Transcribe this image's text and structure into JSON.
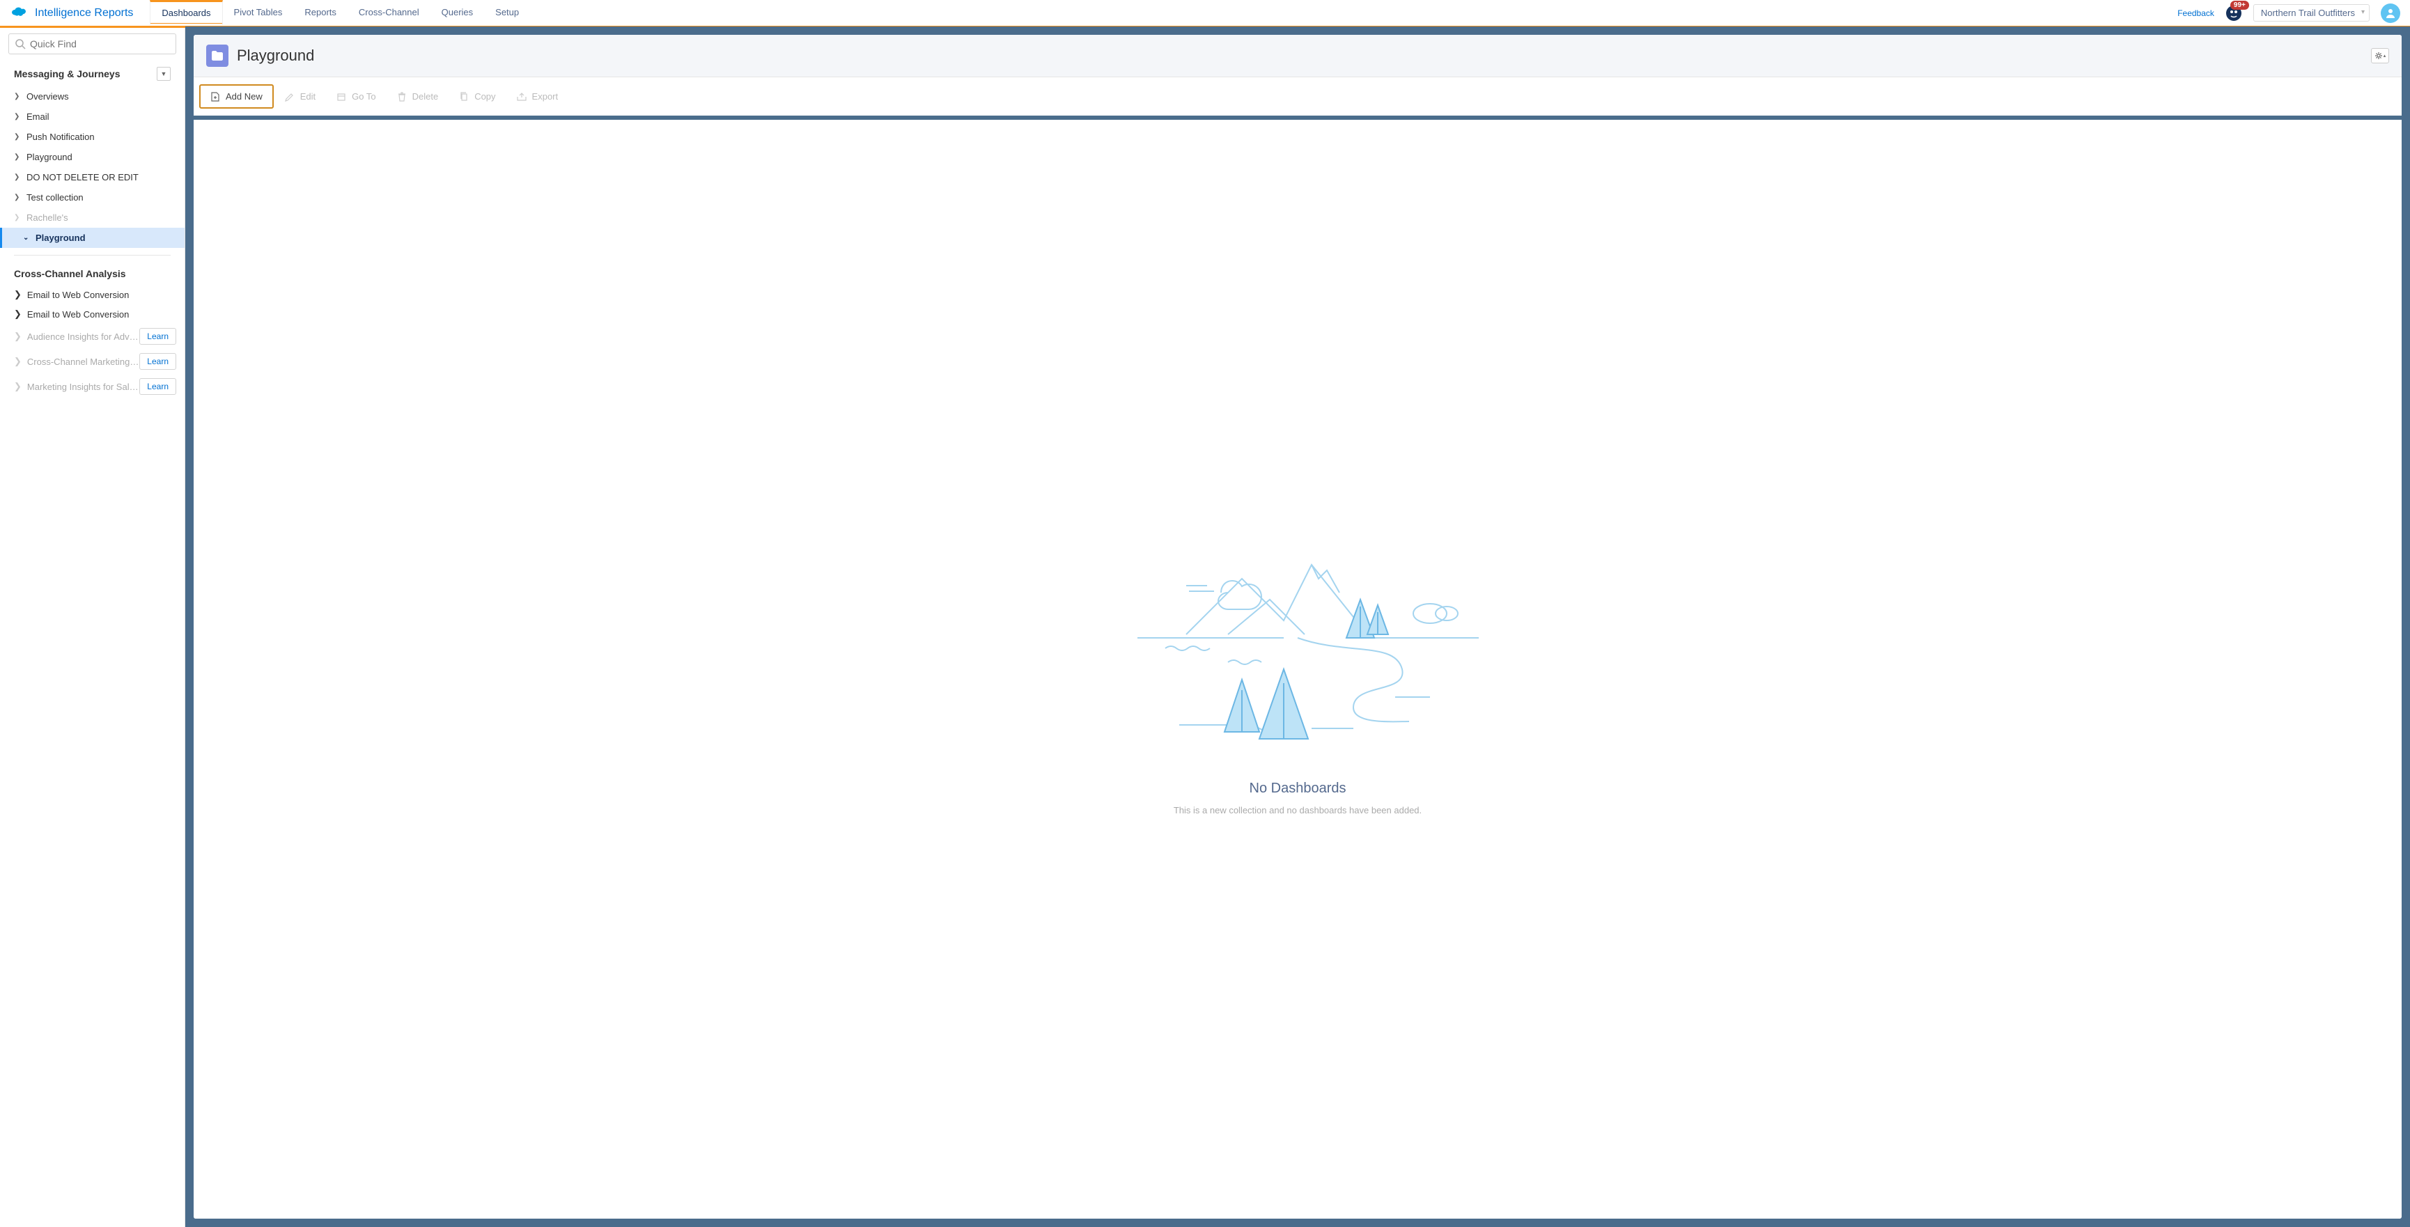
{
  "brand": {
    "name": "Intelligence Reports"
  },
  "nav": {
    "tabs": [
      {
        "label": "Dashboards",
        "active": true
      },
      {
        "label": "Pivot Tables"
      },
      {
        "label": "Reports"
      },
      {
        "label": "Cross-Channel"
      },
      {
        "label": "Queries"
      },
      {
        "label": "Setup"
      }
    ],
    "feedback": "Feedback",
    "badge": "99+",
    "org": "Northern Trail Outfitters"
  },
  "sidebar": {
    "search_placeholder": "Quick Find",
    "section": "Messaging & Journeys",
    "items": [
      {
        "label": "Overviews"
      },
      {
        "label": "Email"
      },
      {
        "label": "Push Notification"
      },
      {
        "label": "Playground"
      },
      {
        "label": "DO NOT DELETE OR EDIT"
      },
      {
        "label": "Test collection"
      },
      {
        "label": "Rachelle's",
        "muted": true
      },
      {
        "label": "Playground",
        "selected": true
      }
    ],
    "section2": "Cross-Channel Analysis",
    "items2": [
      {
        "label": "Email to Web Conversion"
      },
      {
        "label": "Email to Web Conversion"
      },
      {
        "label": "Audience Insights for Adv…",
        "muted": true,
        "learn": true
      },
      {
        "label": "Cross-Channel Marketing …",
        "muted": true,
        "learn": true
      },
      {
        "label": "Marketing Insights for Sal…",
        "muted": true,
        "learn": true
      }
    ],
    "learn_label": "Learn"
  },
  "page": {
    "title": "Playground"
  },
  "toolbar": {
    "add": "Add New",
    "edit": "Edit",
    "goto": "Go To",
    "delete": "Delete",
    "copy": "Copy",
    "export": "Export"
  },
  "empty": {
    "title": "No Dashboards",
    "sub": "This is a new collection and no dashboards have been added."
  }
}
